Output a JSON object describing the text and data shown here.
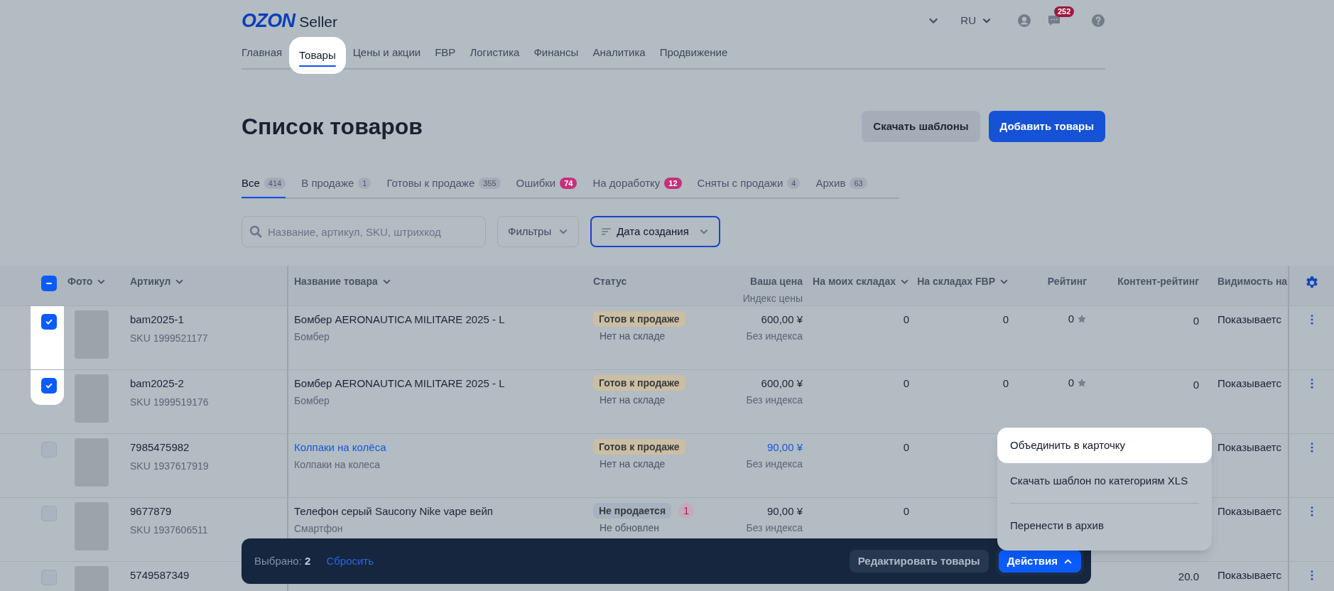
{
  "header": {
    "logo": {
      "brand": "OZON",
      "product": "Seller"
    },
    "language": "RU",
    "notification_count": "252"
  },
  "nav": [
    {
      "label": "Главная",
      "selected": false
    },
    {
      "label": "Товары",
      "selected": true
    },
    {
      "label": "Цены и акции",
      "selected": false
    },
    {
      "label": "FBP",
      "selected": false
    },
    {
      "label": "Логистика",
      "selected": false
    },
    {
      "label": "Финансы",
      "selected": false
    },
    {
      "label": "Аналитика",
      "selected": false
    },
    {
      "label": "Продвижение",
      "selected": false
    }
  ],
  "page_title": "Список товаров",
  "header_buttons": [
    {
      "label": "Скачать шаблоны",
      "kind": "secondary"
    },
    {
      "label": "Добавить товары",
      "kind": "primary"
    }
  ],
  "status_tabs": [
    {
      "label": "Все",
      "count": "414",
      "kind": "plain",
      "selected": true
    },
    {
      "label": "В продаже",
      "count": "1",
      "kind": "plain",
      "selected": false
    },
    {
      "label": "Готовы к продаже",
      "count": "355",
      "kind": "plain",
      "selected": false
    },
    {
      "label": "Ошибки",
      "count": "74",
      "kind": "alert",
      "selected": false
    },
    {
      "label": "На доработку",
      "count": "12",
      "kind": "alert",
      "selected": false
    },
    {
      "label": "Сняты с продажи",
      "count": "4",
      "kind": "plain",
      "selected": false
    },
    {
      "label": "Архив",
      "count": "63",
      "kind": "plain",
      "selected": false
    }
  ],
  "search": {
    "placeholder": "Название, артикул, SKU, штрихкод"
  },
  "filters_button": "Фильтры",
  "sort_button": {
    "label": "Дата создания",
    "active": true
  },
  "table": {
    "select_all": {
      "checked": true,
      "indeterminate": true
    },
    "columns": [
      {
        "label": "Фото",
        "sortable": true
      },
      {
        "label": "Артикул",
        "sortable": true
      },
      {
        "label": "Название товара",
        "sortable": true
      },
      {
        "label": "Статус"
      },
      {
        "label": "Ваша цена",
        "sublabel": "Индекс цены"
      },
      {
        "label": "На моих складах",
        "sortable": true
      },
      {
        "label": "На складах FBP",
        "sortable": true
      },
      {
        "label": "Рейтинг"
      },
      {
        "label": "Контент-рейтинг"
      },
      {
        "label": "Видимость на"
      }
    ],
    "rows": [
      {
        "selected": true,
        "article": "bam2025-1",
        "sku": "SKU 1999521177",
        "name": "Бомбер AERONAUTICA MILITARE 2025 - L",
        "name_link": false,
        "category": "Бомбер",
        "status": {
          "label": "Готов к продаже",
          "color": "#cbbfa3"
        },
        "status_note": "Нет на складе",
        "price": "600,00 ¥",
        "price_link": false,
        "price_index": "Без индекса",
        "my_stock": "0",
        "fbp_stock": "0",
        "rating": "0",
        "content_rating": "0",
        "visibility": "Показываетс"
      },
      {
        "selected": true,
        "article": "bam2025-2",
        "sku": "SKU 1999519176",
        "name": "Бомбер AERONAUTICA MILITARE 2025 - L",
        "name_link": false,
        "category": "Бомбер",
        "status": {
          "label": "Готов к продаже",
          "color": "#cbbfa3"
        },
        "status_note": "Нет на складе",
        "price": "600,00 ¥",
        "price_link": false,
        "price_index": "Без индекса",
        "my_stock": "0",
        "fbp_stock": "0",
        "rating": "0",
        "content_rating": "0",
        "visibility": "Показываетс"
      },
      {
        "selected": false,
        "article": "7985475982",
        "sku": "SKU 1937617919",
        "name": "Колпаки на колёса",
        "name_link": true,
        "category": "Колпаки на колеса",
        "status": {
          "label": "Готов к продаже",
          "color": "#cbbfa3"
        },
        "status_note": "Нет на складе",
        "price": "90,00 ¥",
        "price_link": true,
        "price_index": "Без индекса",
        "my_stock": "0",
        "visibility": "Показываетс"
      },
      {
        "selected": false,
        "article": "9677879",
        "sku": "SKU 1937606511",
        "name": "Телефон серый Saucony Nike vape вейп",
        "name_link": false,
        "category": "Смартфон",
        "status": {
          "label": "Не продается",
          "color": "#a7b2c0"
        },
        "error_count": "1",
        "status_note": "Не обновлен",
        "price": "90,00 ¥",
        "price_link": false,
        "price_index": "Без индекса",
        "my_stock": "0",
        "visibility": "Показываетс"
      },
      {
        "selected": false,
        "article": "5749587349",
        "content_rating": "20.0",
        "visibility": "Показываетс"
      }
    ]
  },
  "selection_bar": {
    "selected_label": "Выбрано:",
    "selected_count": "2",
    "reset_link": "Сбросить",
    "edit_button": "Редактировать товары",
    "actions_button": {
      "label": "Действия",
      "expanded": true
    }
  },
  "actions_menu": [
    {
      "label": "Объединить в карточку",
      "selected": true,
      "divider_before": false
    },
    {
      "label": "Скачать шаблон по категориям XLS",
      "selected": false,
      "divider_before": false
    },
    {
      "label": "Перенести в архив",
      "selected": false,
      "divider_before": true
    }
  ]
}
